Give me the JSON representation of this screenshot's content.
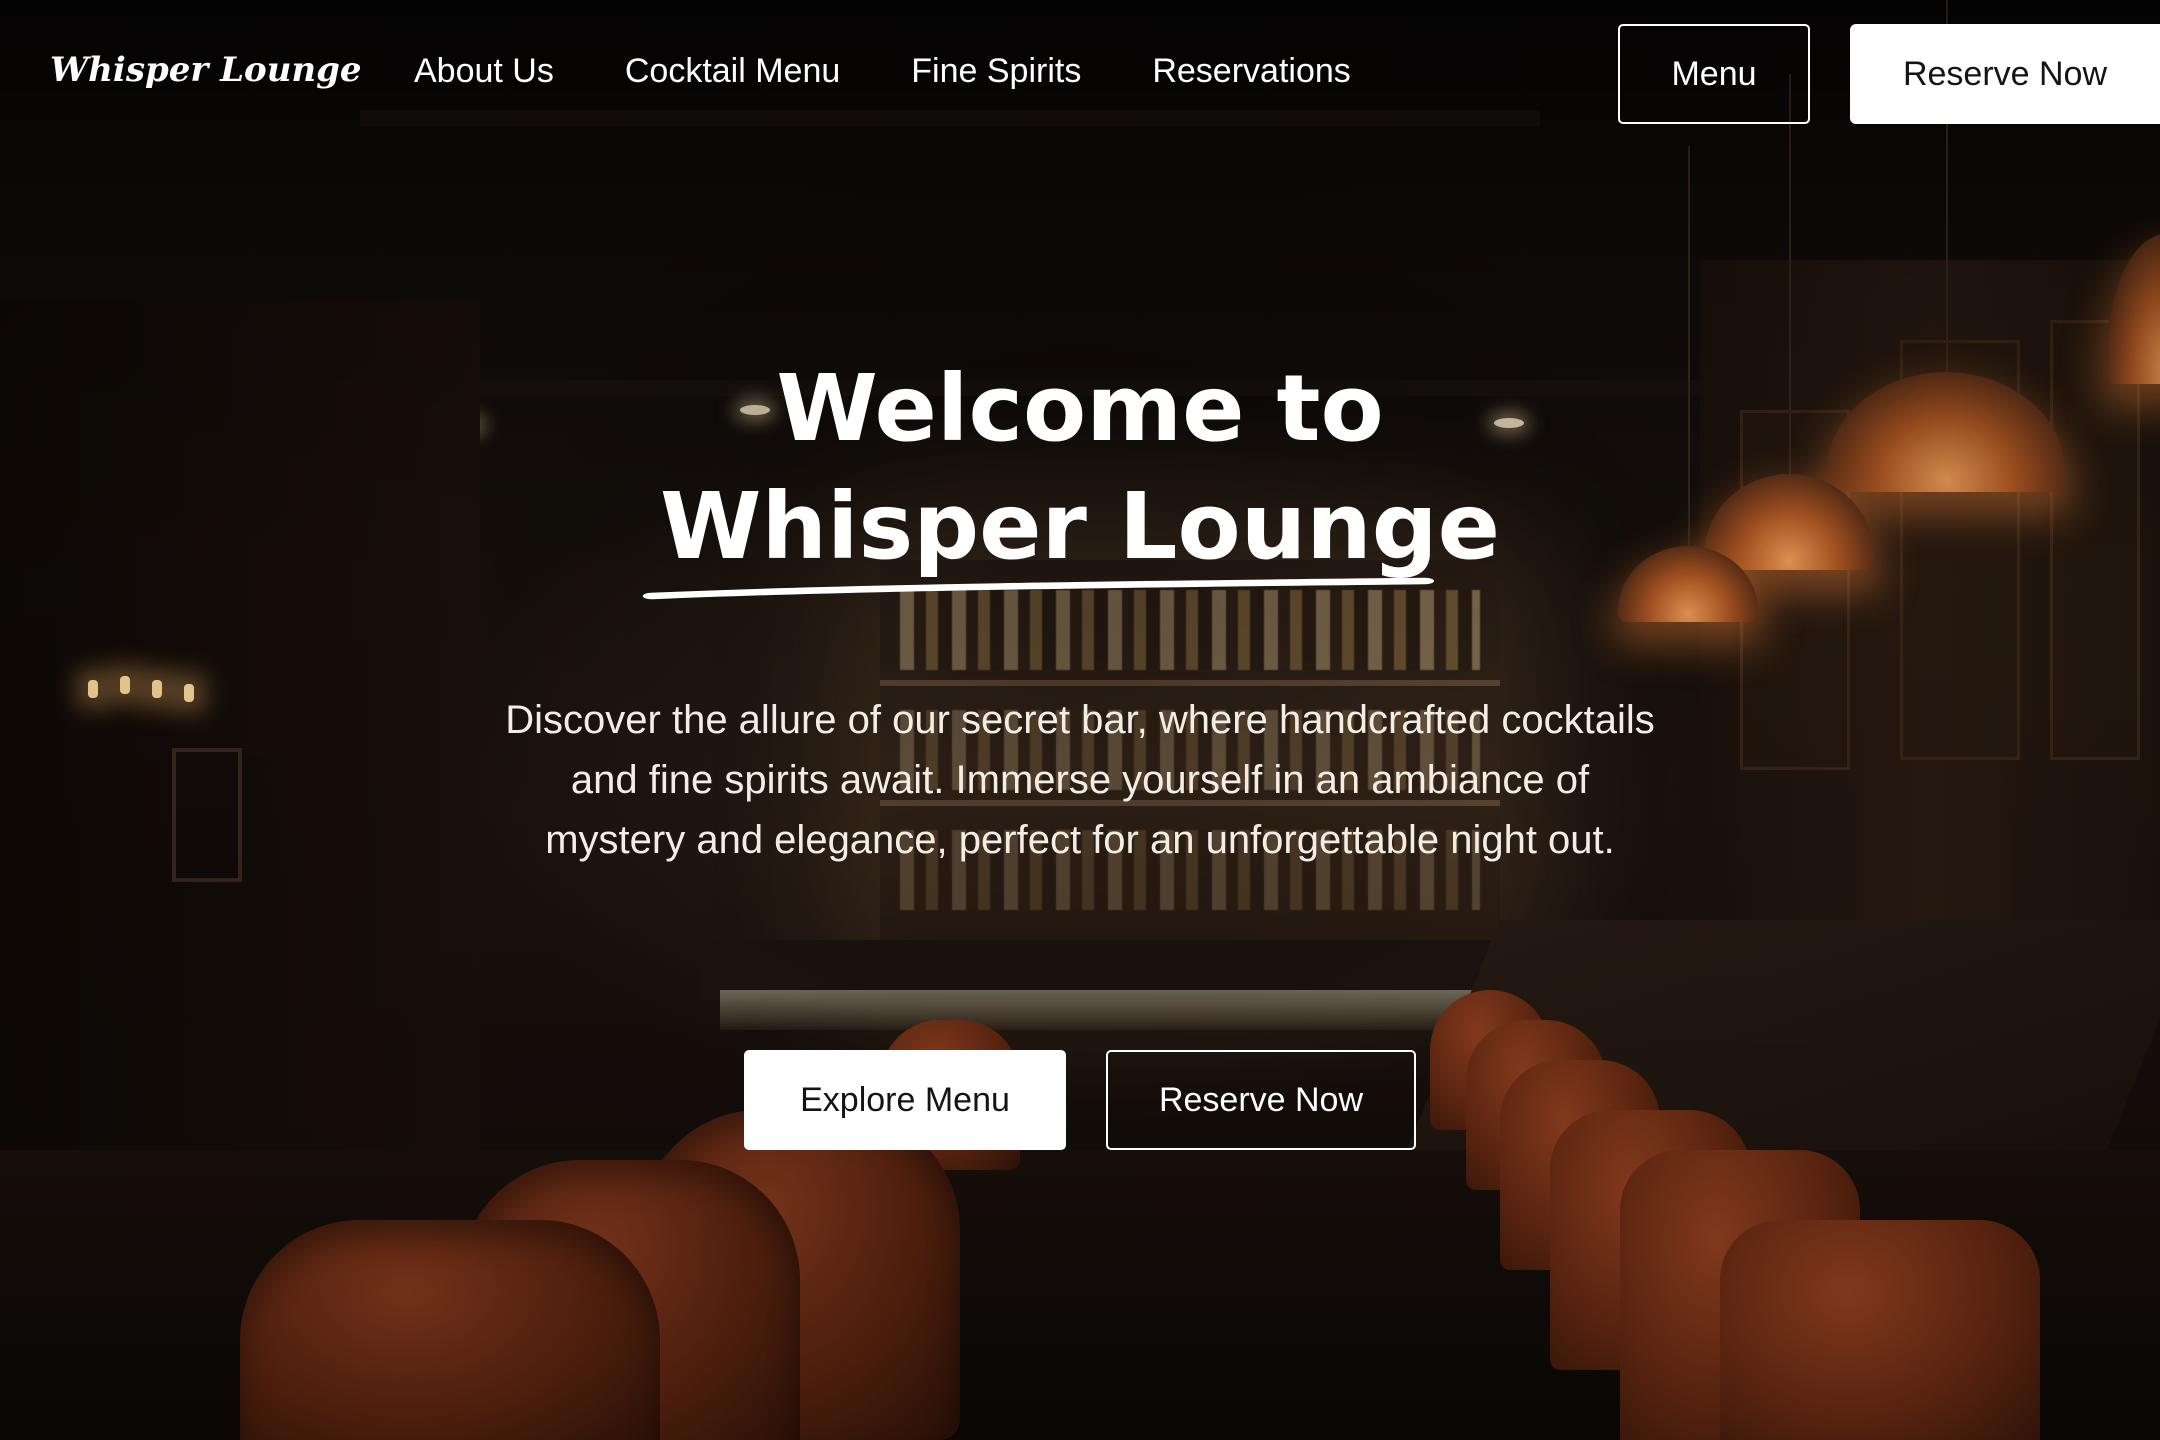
{
  "brand": {
    "logo_text": "Whisper Lounge"
  },
  "nav": {
    "items": [
      {
        "label": "About Us"
      },
      {
        "label": "Cocktail Menu"
      },
      {
        "label": "Fine Spirits"
      },
      {
        "label": "Reservations"
      }
    ]
  },
  "header": {
    "menu_label": "Menu",
    "reserve_label": "Reserve Now"
  },
  "hero": {
    "title_line1": "Welcome to",
    "title_line2": "Whisper Lounge",
    "description": "Discover the allure of our secret bar, where handcrafted cocktails and fine spirits await. Immerse yourself in an ambiance of mystery and elegance, perfect for an unforgettable night out.",
    "primary_cta": "Explore Menu",
    "secondary_cta": "Reserve Now"
  },
  "colors": {
    "text": "#ffffff",
    "button_fill": "#ffffff",
    "button_text": "#141414",
    "accent_lamp": "#f6a25a",
    "chair": "#8a3b1e"
  }
}
